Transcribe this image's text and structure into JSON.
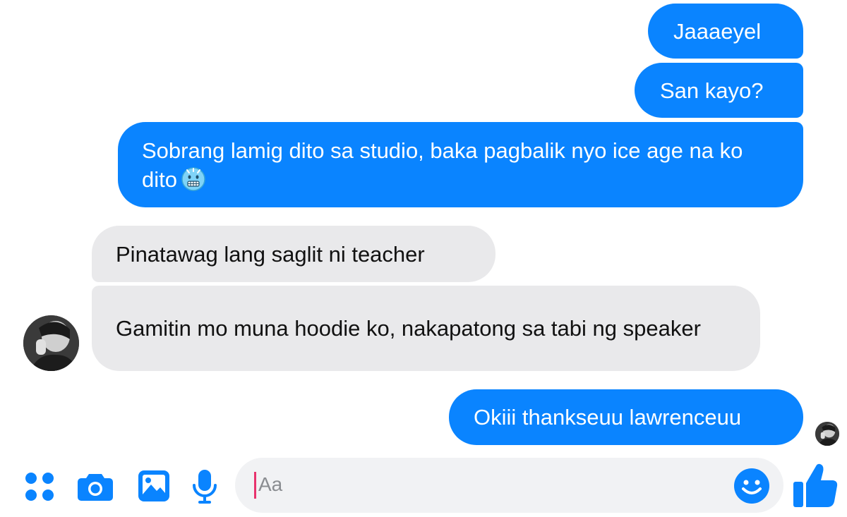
{
  "messages": [
    {
      "id": "b1",
      "direction": "outgoing",
      "text": "Jaaaeyel"
    },
    {
      "id": "b2",
      "direction": "outgoing",
      "text": "San kayo?"
    },
    {
      "id": "b3",
      "direction": "outgoing",
      "text": "Sobrang lamig dito sa studio, baka pagbalik nyo ice age na ko dito",
      "emoji": "cold-face-emoji"
    },
    {
      "id": "b4",
      "direction": "incoming",
      "text": "Pinatawag lang saglit ni teacher"
    },
    {
      "id": "b5",
      "direction": "incoming",
      "text": "Gamitin mo muna hoodie ko, nakapatong sa tabi ng speaker"
    },
    {
      "id": "b6",
      "direction": "outgoing",
      "text": "Okiii thankseuu lawrenceuu"
    }
  ],
  "composer": {
    "placeholder": "Aa",
    "icons": [
      "apps-icon",
      "camera-icon",
      "image-icon",
      "mic-icon",
      "emoji-icon",
      "like-icon"
    ]
  },
  "colors": {
    "outgoing_bubble": "#0a84ff",
    "incoming_bubble": "#e9e9eb",
    "accent": "#0a84ff",
    "caret": "#e8336d"
  }
}
